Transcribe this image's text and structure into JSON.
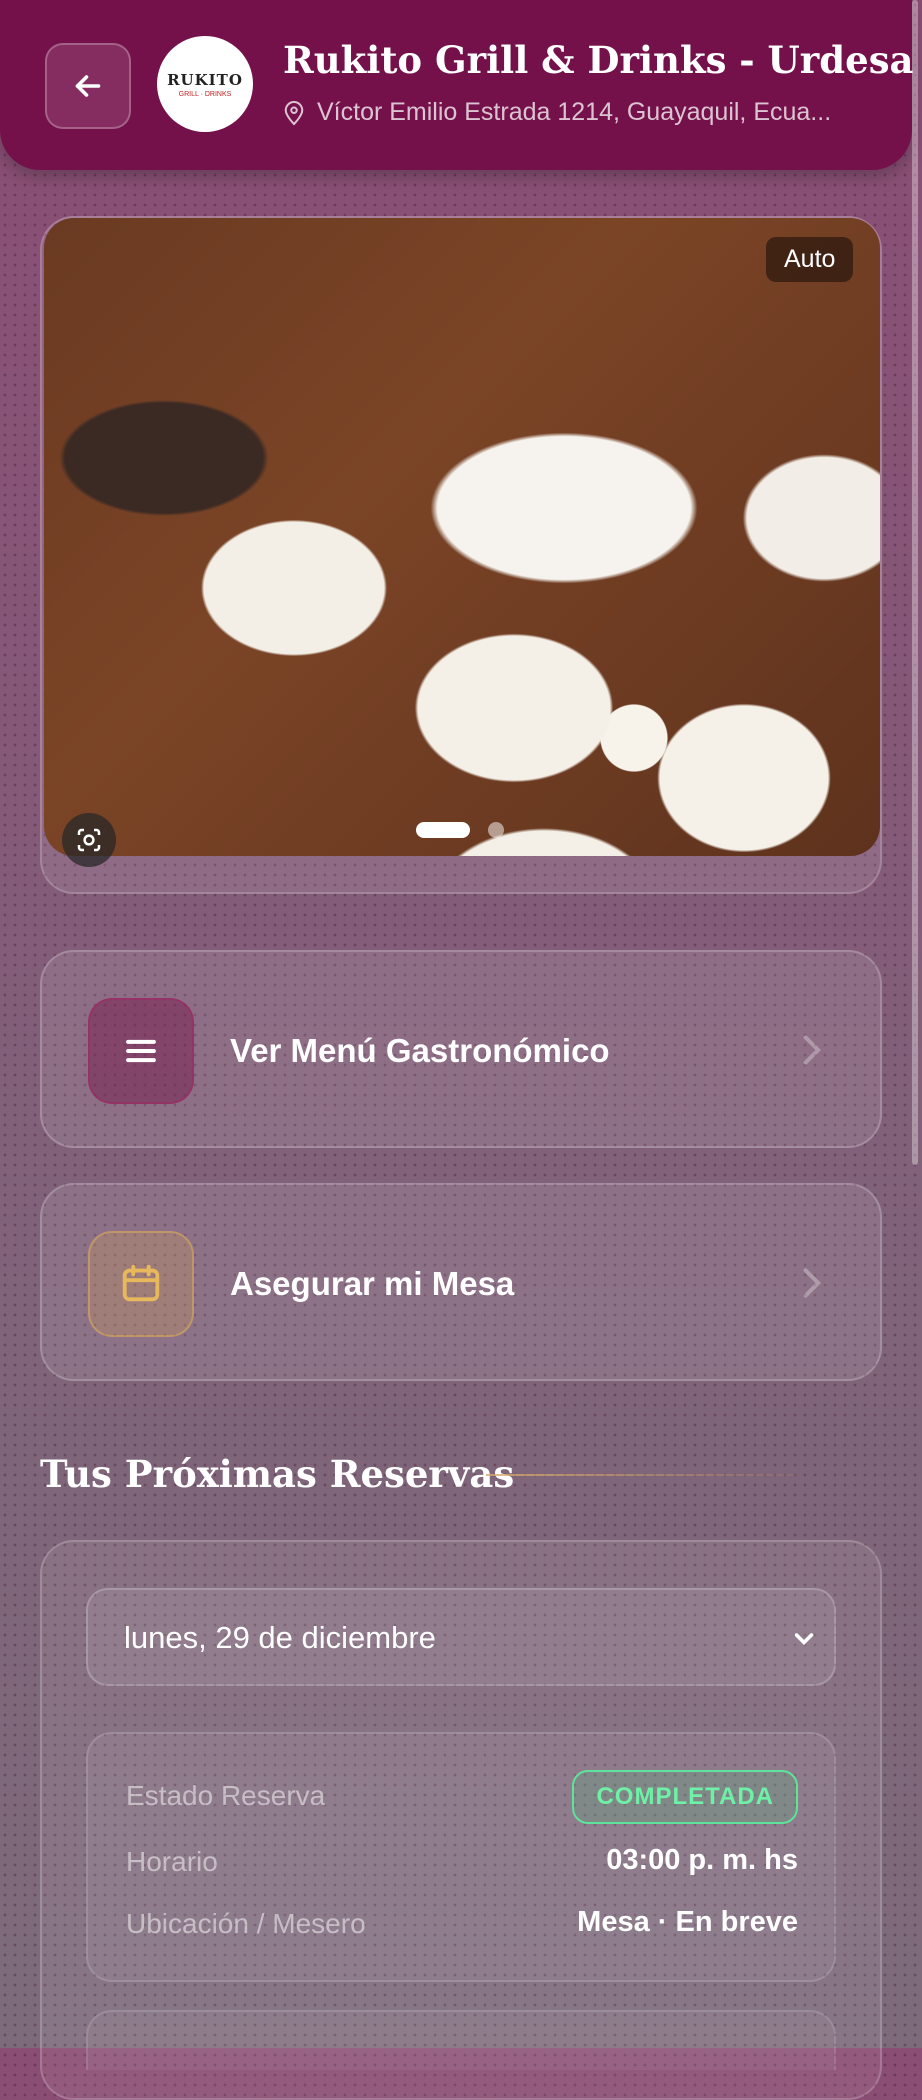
{
  "header": {
    "title": "Rukito Grill & Drinks - Urdesa",
    "address": "Víctor Emilio Estrada 1214, Guayaquil, Ecua...",
    "logo_text": "RUKITO",
    "logo_sub": "GRILL · DRINKS"
  },
  "hero": {
    "badge": "Auto",
    "active_slide": 1,
    "slide_count": 2
  },
  "actions": [
    {
      "label": "Ver Menú Gastronómico",
      "icon": "menu-icon",
      "accent": "#75114a"
    },
    {
      "label": "Asegurar mi Mesa",
      "icon": "calendar-icon",
      "accent": "#e0b05a"
    }
  ],
  "reservations": {
    "section_title": "Tus Próximas Reservas",
    "selected_date": "lunes, 29 de diciembre",
    "details": {
      "status_label": "Estado Reserva",
      "status_value": "COMPLETADA",
      "time_label": "Horario",
      "time_value": "03:00 p. m. hs",
      "location_label": "Ubicación / Mesero",
      "location_value": "Mesa · En breve"
    }
  },
  "colors": {
    "brand": "#75114a",
    "status_completed": "#5ee39b"
  }
}
